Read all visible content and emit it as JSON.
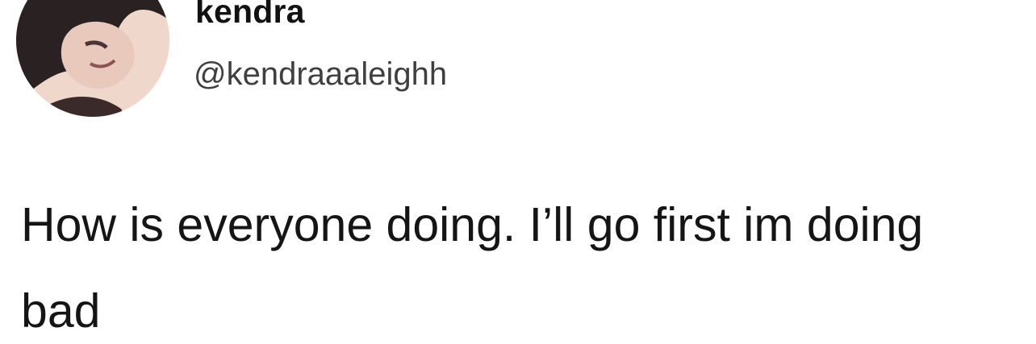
{
  "tweet": {
    "avatar_icon": "profile-photo",
    "display_name": "kendra",
    "handle": "@kendraaaleighh",
    "text": "How is everyone doing. I’ll go first im doing bad"
  }
}
